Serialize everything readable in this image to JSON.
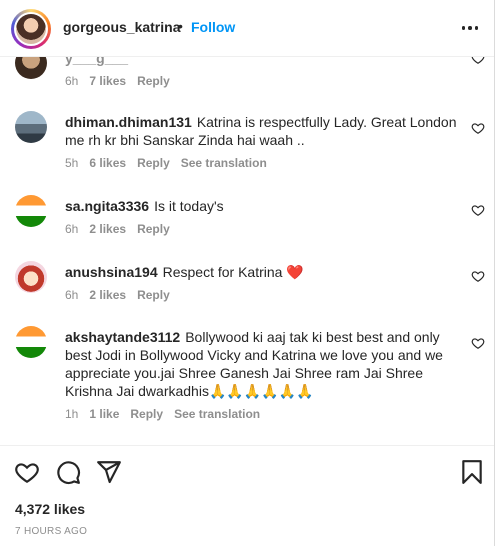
{
  "header": {
    "username": "gorgeous_katrina",
    "separator": "•",
    "follow_label": "Follow",
    "more_icon": "more-horizontal-icon"
  },
  "comments": [
    {
      "username": "y___g___",
      "text": "",
      "time": "6h",
      "likes": "7 likes",
      "reply": "Reply",
      "translate": ""
    },
    {
      "username": "dhiman.dhiman131",
      "text": "Katrina is respectfully Lady. Great London me rh kr bhi Sanskar Zinda hai waah ..",
      "time": "5h",
      "likes": "6 likes",
      "reply": "Reply",
      "translate": "See translation"
    },
    {
      "username": "sa.ngita3336",
      "text": "Is it today's",
      "time": "6h",
      "likes": "2 likes",
      "reply": "Reply",
      "translate": ""
    },
    {
      "username": "anushsina194",
      "text": "Respect for Katrina ❤️",
      "time": "6h",
      "likes": "2 likes",
      "reply": "Reply",
      "translate": ""
    },
    {
      "username": "akshaytande3112",
      "text": "Bollywood ki aaj tak ki best best and only best Jodi in Bollywood Vicky and Katrina we love you and we appreciate you.jai Shree Ganesh Jai Shree ram Jai Shree Krishna Jai dwarkadhis🙏🙏🙏🙏🙏🙏",
      "time": "1h",
      "likes": "1 like",
      "reply": "Reply",
      "translate": "See translation"
    }
  ],
  "actions": {
    "like_icon": "heart-icon",
    "comment_icon": "comment-icon",
    "share_icon": "share-icon",
    "save_icon": "bookmark-icon"
  },
  "likes_count": "4,372 likes",
  "posted_time": "7 HOURS AGO"
}
